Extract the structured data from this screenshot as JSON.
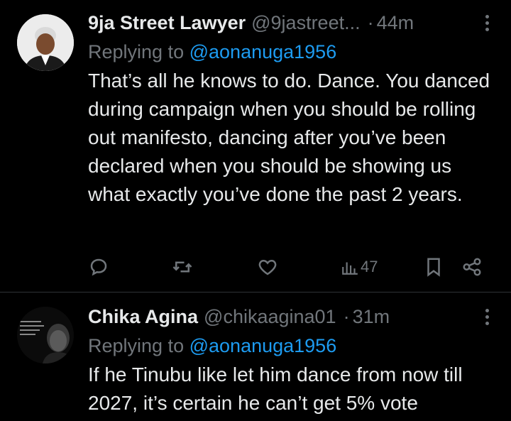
{
  "tweets": [
    {
      "name": "9ja Street Lawyer",
      "handle": "@9jastreet...",
      "time": "44m",
      "replying_label": "Replying to",
      "replying_to": "@aonanuga1956",
      "text": "That’s all he knows to do. Dance. You danced during campaign when you should be rolling out manifesto, dancing after you’ve been declared when you should be showing us what exactly you’ve done the past 2 years.",
      "views": "47"
    },
    {
      "name": "Chika Agina",
      "handle": "@chikaagina01",
      "time": "31m",
      "replying_label": "Replying to",
      "replying_to": "@aonanuga1956",
      "text": "If he Tinubu like let him dance from now till 2027, it’s certain he can’t get 5% vote"
    }
  ],
  "icons": {
    "reply": "reply-icon",
    "retweet": "retweet-icon",
    "like": "like-icon",
    "views": "views-icon",
    "bookmark": "bookmark-icon",
    "share": "share-icon"
  },
  "colors": {
    "background": "#000000",
    "primary_text": "#e7e9ea",
    "secondary_text": "#71767b",
    "link": "#1d9bf0",
    "divider": "#2f3336"
  }
}
